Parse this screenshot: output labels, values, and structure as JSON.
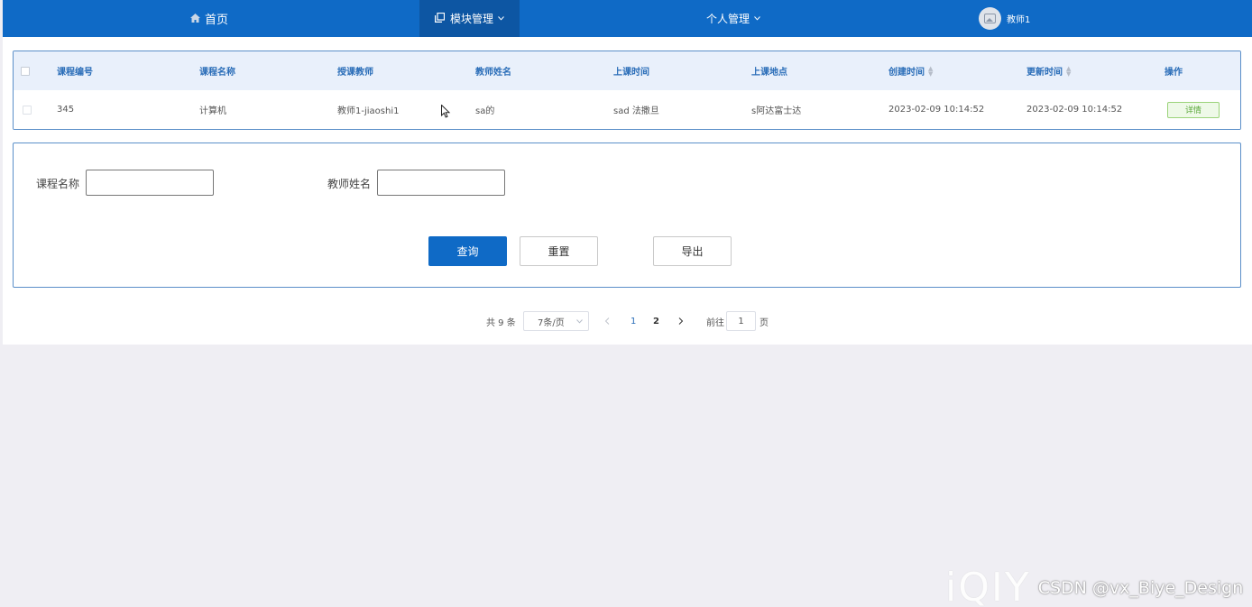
{
  "nav": {
    "home_label": "首页",
    "module_label": "模块管理",
    "personal_label": "个人管理",
    "user_name": "教师1"
  },
  "table": {
    "headers": [
      "课程编号",
      "课程名称",
      "授课教师",
      "教师姓名",
      "上课时间",
      "上课地点",
      "创建时间",
      "更新时间",
      "操作"
    ],
    "rows": [
      {
        "course_no": "345",
        "course_name": "计算机",
        "teacher_account": "教师1-jiaoshi1",
        "teacher_name": "sa的",
        "class_time": "sad 法撒旦",
        "class_place": "s阿达富士达",
        "created_at": "2023-02-09 10:14:52",
        "updated_at": "2023-02-09 10:14:52",
        "action_label": "详情"
      }
    ]
  },
  "search": {
    "course_name_label": "课程名称",
    "course_name_value": "",
    "teacher_name_label": "教师姓名",
    "teacher_name_value": "",
    "query_label": "查询",
    "reset_label": "重置",
    "export_label": "导出"
  },
  "pagination": {
    "total_text": "共 9 条",
    "page_size": "7条/页",
    "pages": [
      "1",
      "2"
    ],
    "current_page": "1",
    "goto_prefix": "前往",
    "goto_value": "1",
    "goto_suffix": "页"
  },
  "watermark": {
    "logo": "iQIY",
    "text": "CSDN @vx_Biye_Design"
  },
  "colors": {
    "nav_bg": "#0f6ac6",
    "nav_active_bg": "#0d56a3",
    "primary": "#0f6ac6",
    "header_bg": "#e9f0fb"
  }
}
